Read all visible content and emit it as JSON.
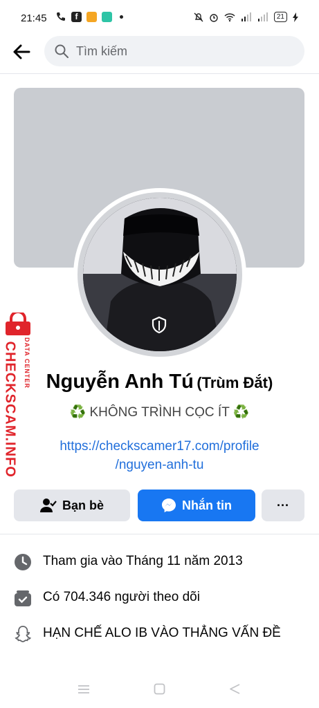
{
  "status_bar": {
    "time": "21:45",
    "battery": "21",
    "icons": [
      "call-icon",
      "facebook-icon",
      "app-icon",
      "chat-icon",
      "bell-muted-icon",
      "alarm-icon",
      "wifi-icon",
      "signal-icon",
      "charging-icon"
    ]
  },
  "header": {
    "search_placeholder": "Tìm kiếm"
  },
  "profile": {
    "name": "Nguyễn Anh Tú",
    "nickname": "(Trùm Đắt)",
    "bio": "♻️ KHÔNG TRÌNH CỌC ÍT ♻️",
    "link_line1": "https://checkscamer17.com/profile",
    "link_line2": "/nguyen-anh-tu"
  },
  "actions": {
    "friends_label": "Bạn bè",
    "message_label": "Nhắn tin",
    "more_label": "···"
  },
  "info": [
    {
      "icon": "clock-icon",
      "text": "Tham gia vào Tháng 11 năm 2013"
    },
    {
      "icon": "followers-icon",
      "text": "Có 704.346 người theo dõi"
    },
    {
      "icon": "snapchat-icon",
      "text": "HẠN CHẾ ALO IB VÀO THẲNG VẤN ĐỀ"
    }
  ],
  "watermark": {
    "brand": "CHECKSCAM.INFO",
    "tag": "DATA CENTER"
  },
  "colors": {
    "accent": "#1877f2",
    "link": "#216fdb",
    "watermark": "#e0242b"
  }
}
